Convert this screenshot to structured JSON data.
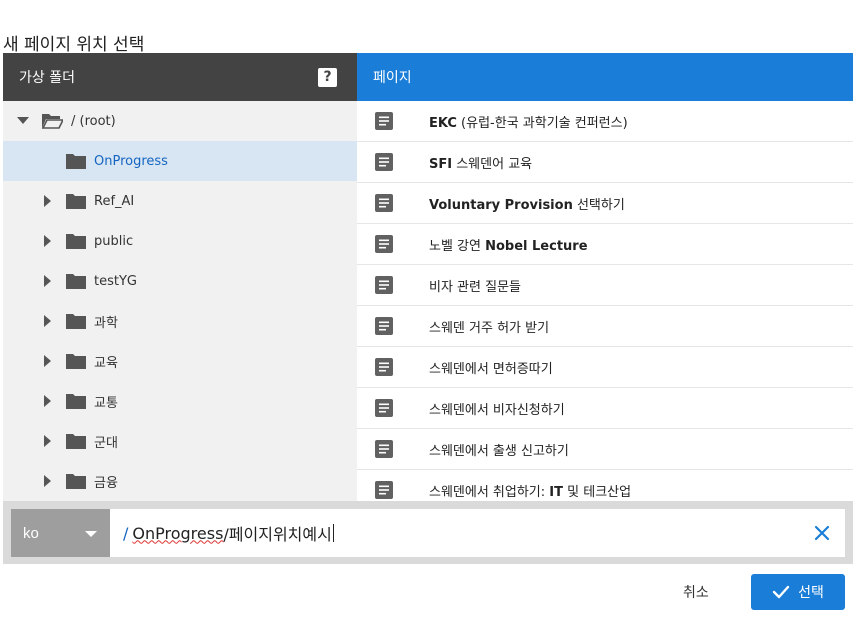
{
  "dialog": {
    "title": "새 페이지 위치 선택",
    "folders_header": "가상 폴더",
    "help_label": "?",
    "pages_header": "페이지"
  },
  "folders": [
    {
      "label": "/ (root)",
      "expanded": true,
      "selected": false,
      "level": 0
    },
    {
      "label": "OnProgress",
      "expanded": false,
      "selected": true,
      "level": 1,
      "has_children": false
    },
    {
      "label": "Ref_AI",
      "expanded": false,
      "selected": false,
      "level": 1,
      "has_children": true
    },
    {
      "label": "public",
      "expanded": false,
      "selected": false,
      "level": 1,
      "has_children": true
    },
    {
      "label": "testYG",
      "expanded": false,
      "selected": false,
      "level": 1,
      "has_children": true
    },
    {
      "label": "과학",
      "expanded": false,
      "selected": false,
      "level": 1,
      "has_children": true
    },
    {
      "label": "교육",
      "expanded": false,
      "selected": false,
      "level": 1,
      "has_children": true
    },
    {
      "label": "교통",
      "expanded": false,
      "selected": false,
      "level": 1,
      "has_children": true
    },
    {
      "label": "군대",
      "expanded": false,
      "selected": false,
      "level": 1,
      "has_children": true
    },
    {
      "label": "금융",
      "expanded": false,
      "selected": false,
      "level": 1,
      "has_children": true
    }
  ],
  "pages": [
    {
      "bold": "EKC",
      "rest": " (유럽-한국 과학기술 컨퍼런스)"
    },
    {
      "bold": "SFI",
      "rest": " 스웨덴어 교육"
    },
    {
      "bold": "Voluntary Provision",
      "rest": " 선택하기"
    },
    {
      "bold": "",
      "rest": "노벨 강연 ",
      "bold2": "Nobel Lecture"
    },
    {
      "bold": "",
      "rest": "비자 관련 질문들"
    },
    {
      "bold": "",
      "rest": "스웨덴 거주 허가 받기"
    },
    {
      "bold": "",
      "rest": "스웨덴에서 면허증따기"
    },
    {
      "bold": "",
      "rest": "스웨덴에서 비자신청하기"
    },
    {
      "bold": "",
      "rest": "스웨덴에서 출생 신고하기"
    },
    {
      "bold": "",
      "rest": "스웨덴에서 취업하기: ",
      "bold2": "IT",
      "rest2": " 및 테크산업"
    }
  ],
  "bottom": {
    "locale": "ko",
    "path_slash": "/",
    "path_folder": "OnProgress",
    "path_page": "/페이지위치예시"
  },
  "footer": {
    "cancel_label": "취소",
    "select_label": "선택"
  },
  "colors": {
    "accent": "#1a7dd7",
    "folders_header_bg": "#434343",
    "selected_row_bg": "#d8e6f4"
  }
}
